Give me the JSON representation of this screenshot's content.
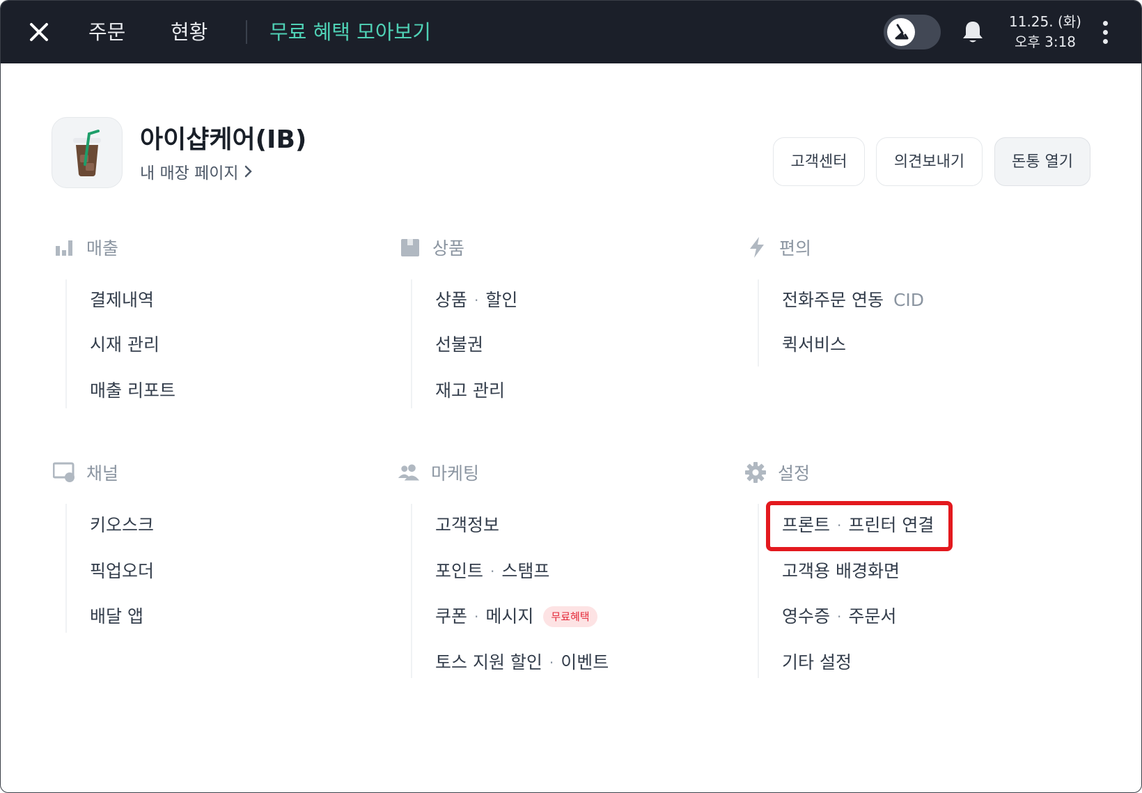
{
  "topbar": {
    "tabs": [
      {
        "label": "주문"
      },
      {
        "label": "현황"
      },
      {
        "label": "무료 혜택 모아보기"
      }
    ],
    "date": "11.25. (화)",
    "time": "오후 3:18",
    "accent_color": "#4fd1b5"
  },
  "store": {
    "name": "아이샵케어(IB)",
    "page_link": "내 매장 페이지"
  },
  "header_buttons": {
    "customer_center": "고객센터",
    "feedback": "의견보내기",
    "open_drawer": "돈통 열기"
  },
  "sections": {
    "sales": {
      "title": "매출",
      "items": [
        "결제내역",
        "시재 관리",
        "매출 리포트"
      ]
    },
    "products": {
      "title": "상품",
      "item1": {
        "a": "상품",
        "b": "할인"
      },
      "item2": "선불권",
      "item3": "재고 관리"
    },
    "convenience": {
      "title": "편의",
      "item1": {
        "label": "전화주문 연동",
        "tag": "CID"
      },
      "item2": "퀵서비스"
    },
    "channel": {
      "title": "채널",
      "items": [
        "키오스크",
        "픽업오더",
        "배달 앱"
      ]
    },
    "marketing": {
      "title": "마케팅",
      "item1": "고객정보",
      "item2": {
        "a": "포인트",
        "b": "스탬프"
      },
      "item3": {
        "a": "쿠폰",
        "b": "메시지",
        "badge": "무료혜택"
      },
      "item4": {
        "a": "토스 지원 할인",
        "b": "이벤트"
      }
    },
    "settings": {
      "title": "설정",
      "item1": {
        "a": "프론트",
        "b": "프린터 연결"
      },
      "item2": "고객용 배경화면",
      "item3": {
        "a": "영수증",
        "b": "주문서"
      },
      "item4": "기타 설정"
    }
  },
  "separator": "·"
}
